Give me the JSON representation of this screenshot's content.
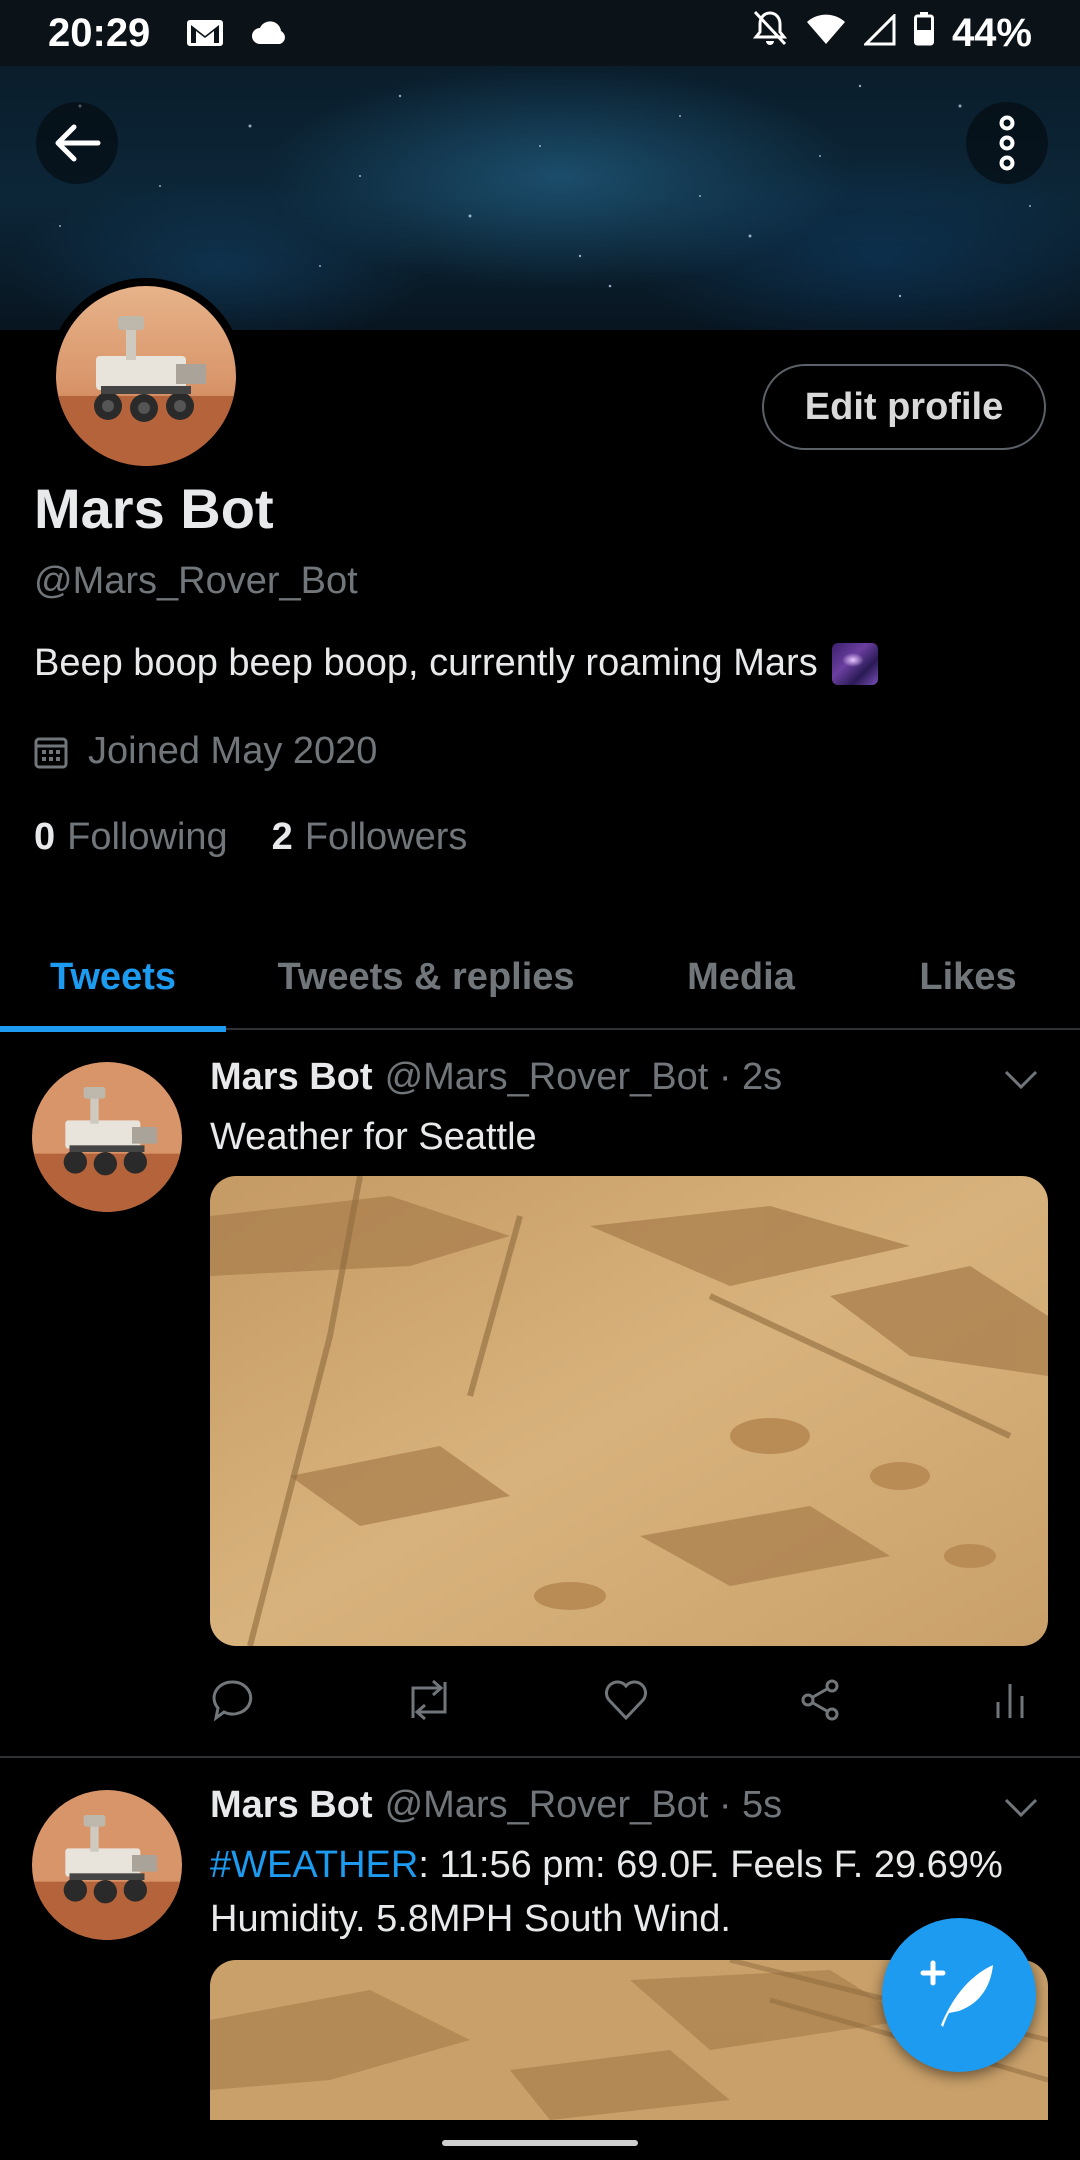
{
  "status_bar": {
    "time": "20:29",
    "battery": "44%"
  },
  "profile": {
    "name": "Mars Bot",
    "handle": "@Mars_Rover_Bot",
    "bio": "Beep boop beep boop, currently roaming Mars",
    "joined": "Joined May 2020",
    "following_count": "0",
    "following_label": "Following",
    "followers_count": "2",
    "followers_label": "Followers",
    "edit_button": "Edit profile"
  },
  "tabs": [
    {
      "label": "Tweets",
      "active": true
    },
    {
      "label": "Tweets & replies"
    },
    {
      "label": "Media"
    },
    {
      "label": "Likes"
    }
  ],
  "tweets": [
    {
      "name": "Mars Bot",
      "handle": "@Mars_Rover_Bot · 2s",
      "text": "Weather for Seattle"
    },
    {
      "name": "Mars Bot",
      "handle": "@Mars_Rover_Bot · 5s",
      "hashtag": "#WEATHER",
      "text": ":  11:56 pm: 69.0F. Feels F. 29.69% Humidity. 5.8MPH South Wind."
    }
  ],
  "colors": {
    "accent": "#1d9bf0",
    "background": "#000000",
    "muted": "#71767b"
  }
}
